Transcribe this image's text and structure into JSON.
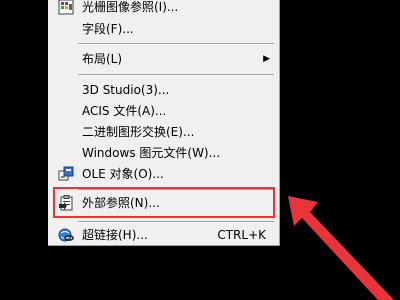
{
  "menu": {
    "items": [
      {
        "label": "光栅图像参照(I)...",
        "icon": "raster-image-icon"
      },
      {
        "label": "字段(F)..."
      },
      {
        "label": "布局(L)",
        "submenu": true
      },
      {
        "label": "3D Studio(3)..."
      },
      {
        "label": "ACIS 文件(A)..."
      },
      {
        "label": "二进制图形交换(E)..."
      },
      {
        "label": "Windows 图元文件(W)..."
      },
      {
        "label": "OLE 对象(O)...",
        "icon": "ole-object-icon"
      },
      {
        "label": "外部参照(N)...",
        "icon": "external-reference-icon",
        "highlighted": true
      },
      {
        "label": "超链接(H)...",
        "icon": "hyperlink-icon",
        "shortcut": "CTRL+K"
      }
    ]
  },
  "colors": {
    "highlight": "#e8343b",
    "arrow": "#e8343b",
    "menu_bg": "#f0f0f0",
    "background": "#000000"
  }
}
